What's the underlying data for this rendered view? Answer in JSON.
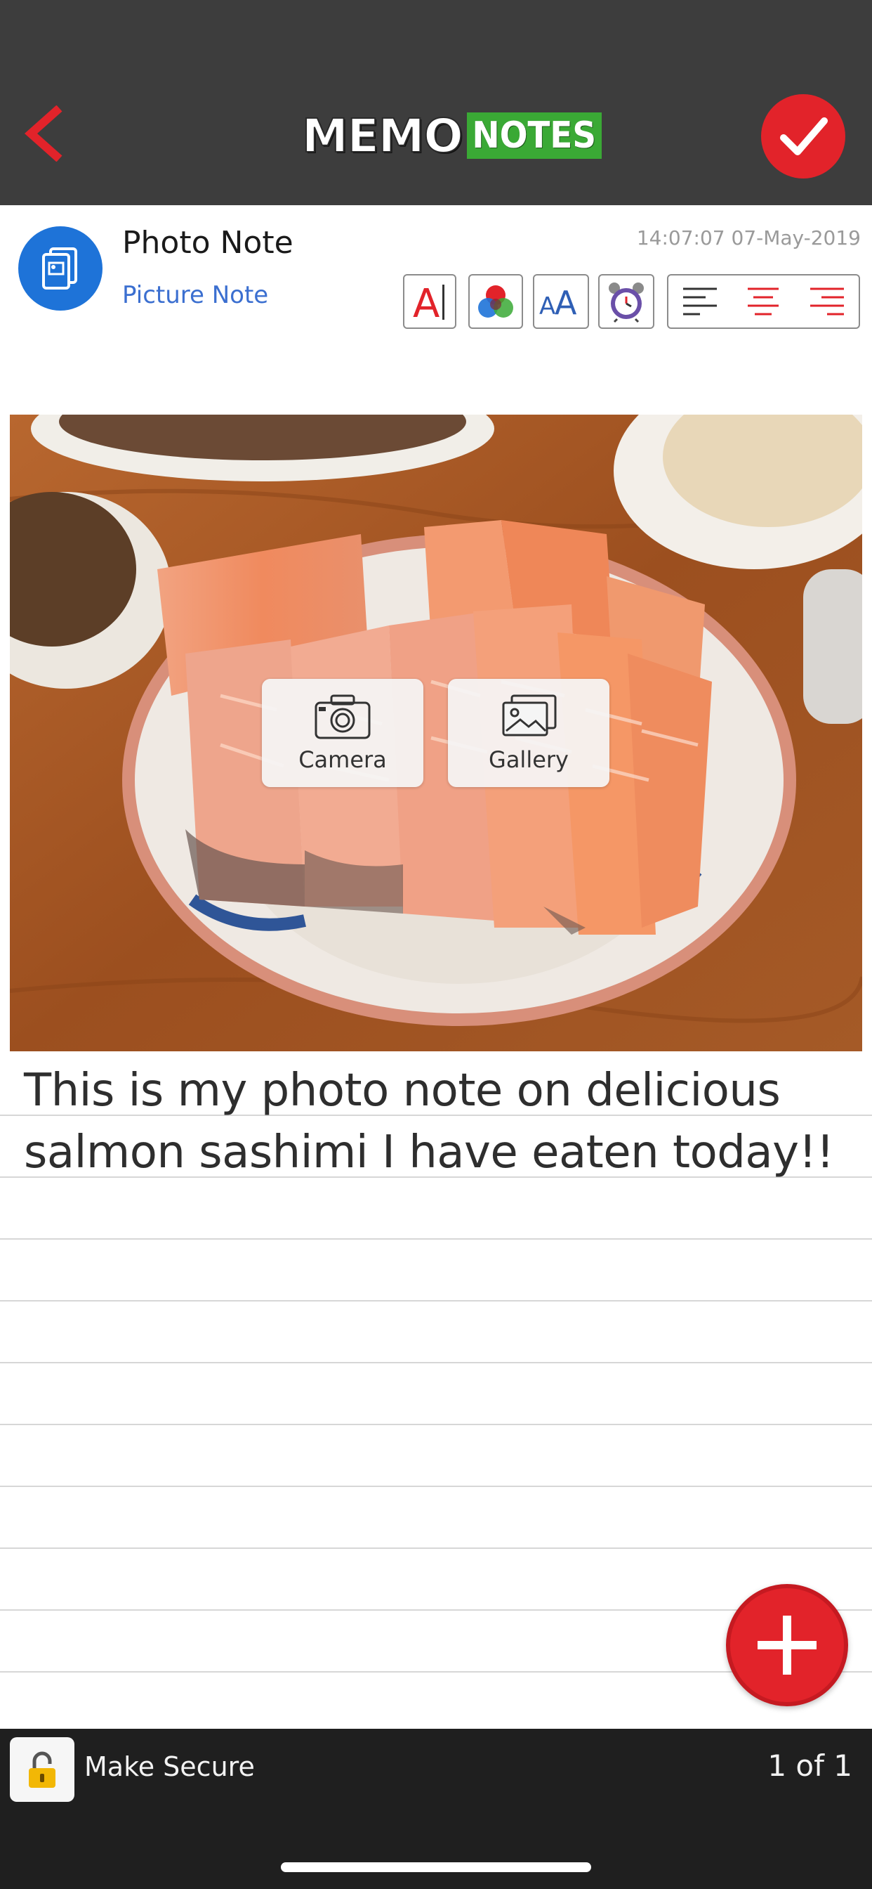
{
  "header": {
    "logo_part1": "MEMO",
    "logo_part2": "NOTES",
    "back_icon": "chevron-left-icon",
    "done_icon": "checkmark-icon",
    "accent_color": "#e2232a",
    "logo_green": "#3aa935"
  },
  "note": {
    "title": "Photo Note",
    "type": "Picture Note",
    "timestamp": "14:07:07 07-May-2019",
    "type_icon": "photo-note-icon",
    "body": "This is my photo note on delicious salmon sashimi I have eaten today!!"
  },
  "toolbar": {
    "tools": [
      "text-color-icon",
      "color-palette-icon",
      "font-size-icon",
      "alarm-clock-icon",
      "align-left-icon",
      "align-center-icon",
      "align-right-icon"
    ]
  },
  "photo": {
    "camera_label": "Camera",
    "gallery_label": "Gallery"
  },
  "bottom": {
    "secure_label": "Make Secure",
    "page_count": "1 of 1",
    "lock_icon": "padlock-icon"
  }
}
